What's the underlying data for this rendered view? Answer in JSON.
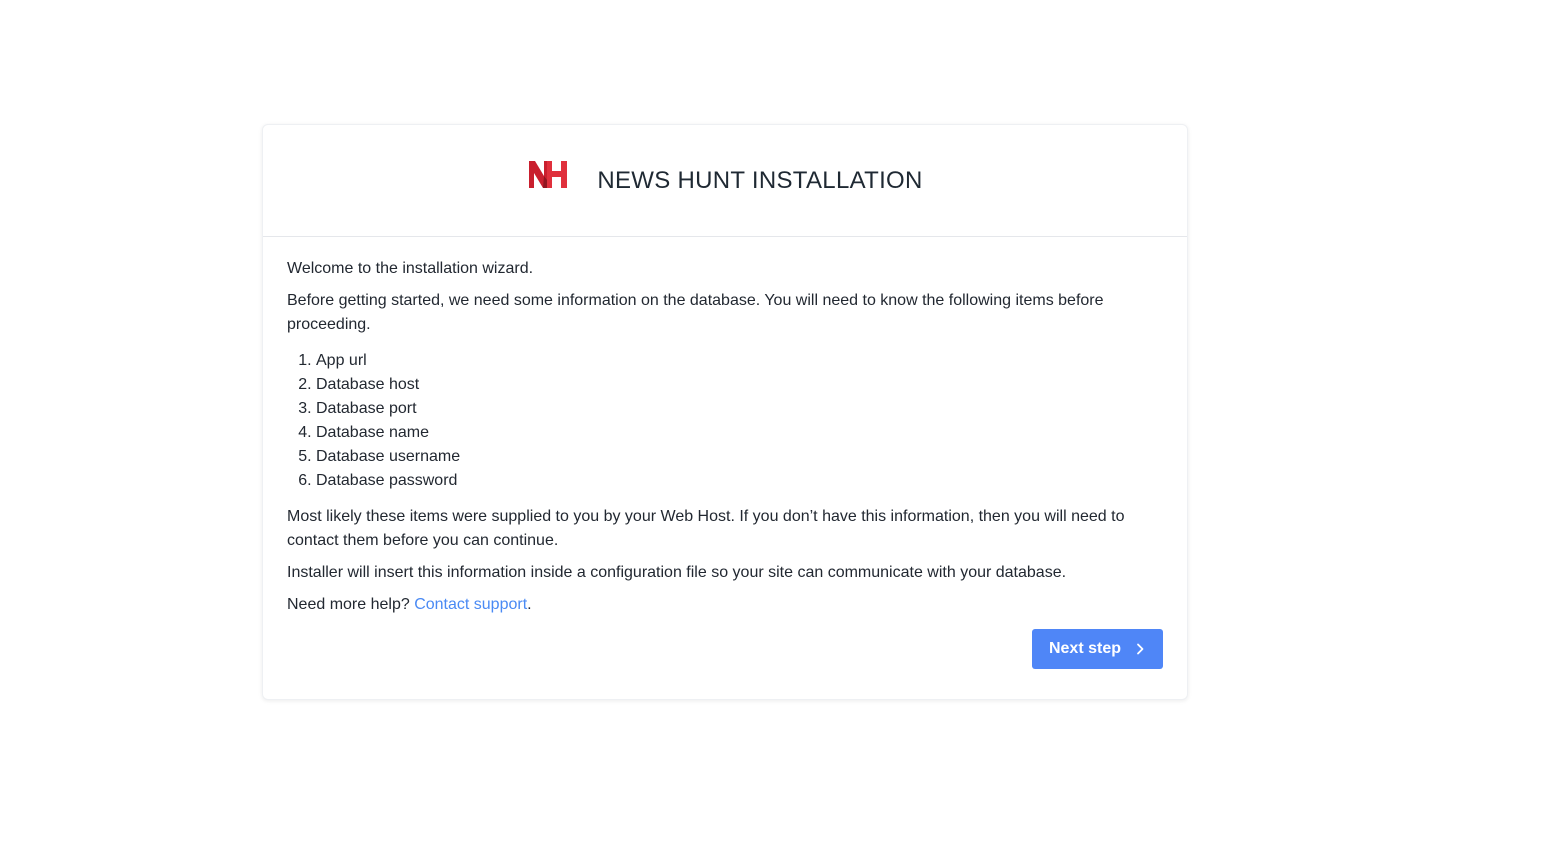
{
  "header": {
    "logo_icon": "news-hunt-nh-logo",
    "title": "NEWS HUNT INSTALLATION"
  },
  "body": {
    "welcome": "Welcome to the installation wizard.",
    "intro": "Before getting started, we need some information on the database. You will need to know the following items before proceeding.",
    "items": [
      "App url",
      "Database host",
      "Database port",
      "Database name",
      "Database username",
      "Database password"
    ],
    "supplied_note": "Most likely these items were supplied to you by your Web Host. If you don’t have this information, then you will need to contact them before you can continue.",
    "installer_note": "Installer will insert this information inside a configuration file so your site can communicate with your database.",
    "help_prefix": "Need more help? ",
    "help_link": "Contact support",
    "help_suffix": "."
  },
  "actions": {
    "next_label": "Next step",
    "next_icon": "chevron-right-icon"
  },
  "colors": {
    "accent": "#4f86f7",
    "link": "#4a8af4",
    "logo_red": "#d3202f"
  }
}
